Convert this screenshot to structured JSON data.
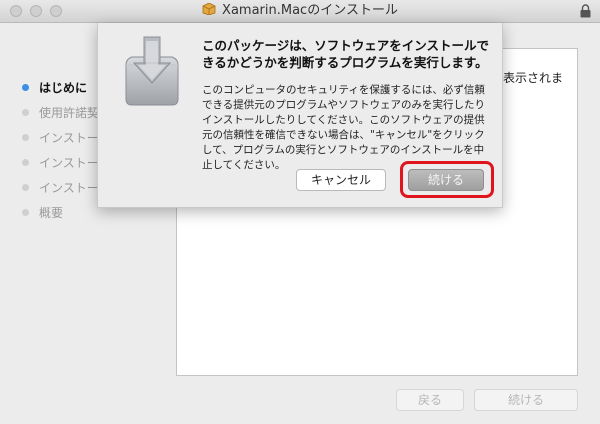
{
  "window": {
    "title": "Xamarin.Macのインストール"
  },
  "colors": {
    "accent": "#3a8ee6",
    "highlight": "#e0141c"
  },
  "sidebar": {
    "steps": [
      {
        "label": "はじめに",
        "active": true
      },
      {
        "label": "使用許諾契約",
        "active": false
      },
      {
        "label": "インストール先",
        "active": false
      },
      {
        "label": "インストールの種類",
        "active": false
      },
      {
        "label": "インストール",
        "active": false
      },
      {
        "label": "概要",
        "active": false
      }
    ]
  },
  "content": {
    "visible_text": "表示されま"
  },
  "footer": {
    "back_label": "戻る",
    "continue_label": "続ける"
  },
  "dialog": {
    "icon": "installer-package-icon",
    "heading": "このパッケージは、ソフトウェアをインストールできるかどうかを判断するプログラムを実行します。",
    "body": "このコンピュータのセキュリティを保護するには、必ず信頼できる提供元のプログラムやソフトウェアのみを実行したりインストールしたりしてください。このソフトウェアの提供元の信頼性を確信できない場合は、\"キャンセル\"をクリックして、プログラムの実行とソフトウェアのインストールを中止してください。",
    "cancel_label": "キャンセル",
    "continue_label": "続ける"
  }
}
